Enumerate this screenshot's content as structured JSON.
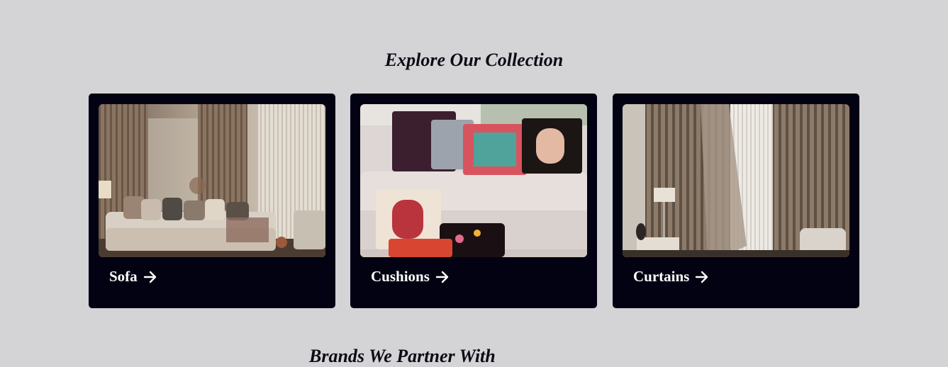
{
  "collection": {
    "title": "Explore Our Collection",
    "cards": [
      {
        "label": "Sofa",
        "icon": "arrow-right-icon"
      },
      {
        "label": "Cushions",
        "icon": "arrow-right-icon"
      },
      {
        "label": "Curtains",
        "icon": "arrow-right-icon"
      }
    ]
  },
  "next_section": {
    "title": "Brands We Partner With"
  },
  "colors": {
    "page_bg": "#d4d4d7",
    "card_bg": "#020212",
    "text_light": "#ffffff",
    "text_dark": "#0b0b14"
  }
}
